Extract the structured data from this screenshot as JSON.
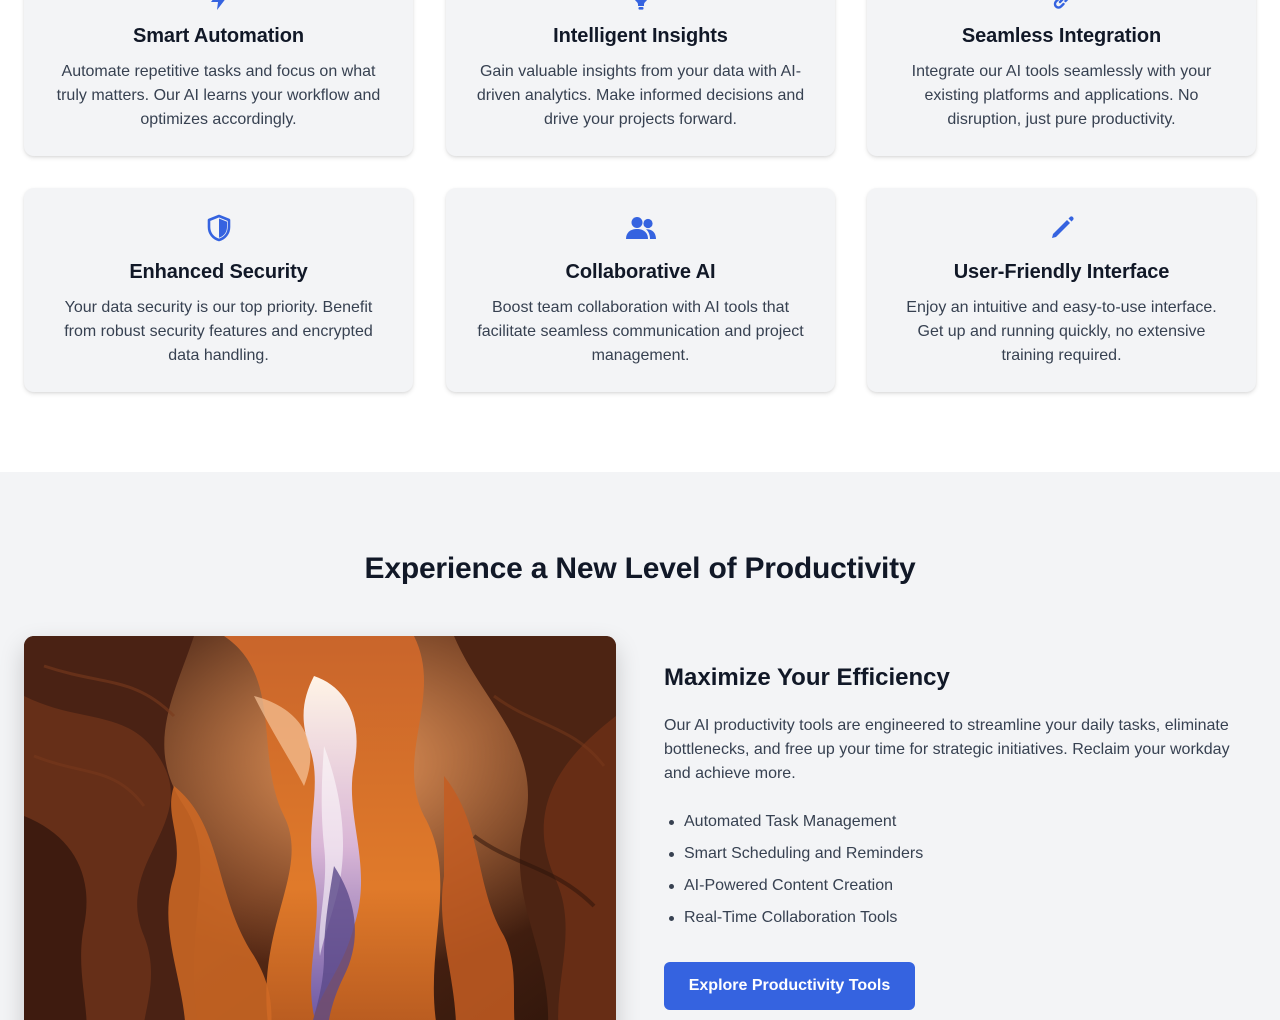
{
  "colors": {
    "accent": "#3563e0",
    "card_bg": "#f3f4f6",
    "section_bg": "#f3f4f6",
    "heading": "#111827",
    "body_text": "#374151"
  },
  "features": {
    "cards": [
      {
        "icon": "lightning-icon",
        "title": "Smart Automation",
        "description": "Automate repetitive tasks and focus on what truly matters. Our AI learns your workflow and optimizes accordingly."
      },
      {
        "icon": "lightbulb-icon",
        "title": "Intelligent Insights",
        "description": "Gain valuable insights from your data with AI-driven analytics. Make informed decisions and drive your projects forward."
      },
      {
        "icon": "link-icon",
        "title": "Seamless Integration",
        "description": "Integrate our AI tools seamlessly with your existing platforms and applications. No disruption, just pure productivity."
      },
      {
        "icon": "shield-icon",
        "title": "Enhanced Security",
        "description": "Your data security is our top priority. Benefit from robust security features and encrypted data handling."
      },
      {
        "icon": "users-icon",
        "title": "Collaborative AI",
        "description": "Boost team collaboration with AI tools that facilitate seamless communication and project management."
      },
      {
        "icon": "pencil-icon",
        "title": "User-Friendly Interface",
        "description": "Enjoy an intuitive and easy-to-use interface. Get up and running quickly, no extensive training required."
      }
    ]
  },
  "productivity": {
    "heading": "Experience a New Level of Productivity",
    "image": "canyon-photo",
    "subheading": "Maximize Your Efficiency",
    "description": "Our AI productivity tools are engineered to streamline your daily tasks, eliminate bottlenecks, and free up your time for strategic initiatives. Reclaim your workday and achieve more.",
    "list": [
      "Automated Task Management",
      "Smart Scheduling and Reminders",
      "AI-Powered Content Creation",
      "Real-Time Collaboration Tools"
    ],
    "cta_label": "Explore Productivity Tools"
  }
}
